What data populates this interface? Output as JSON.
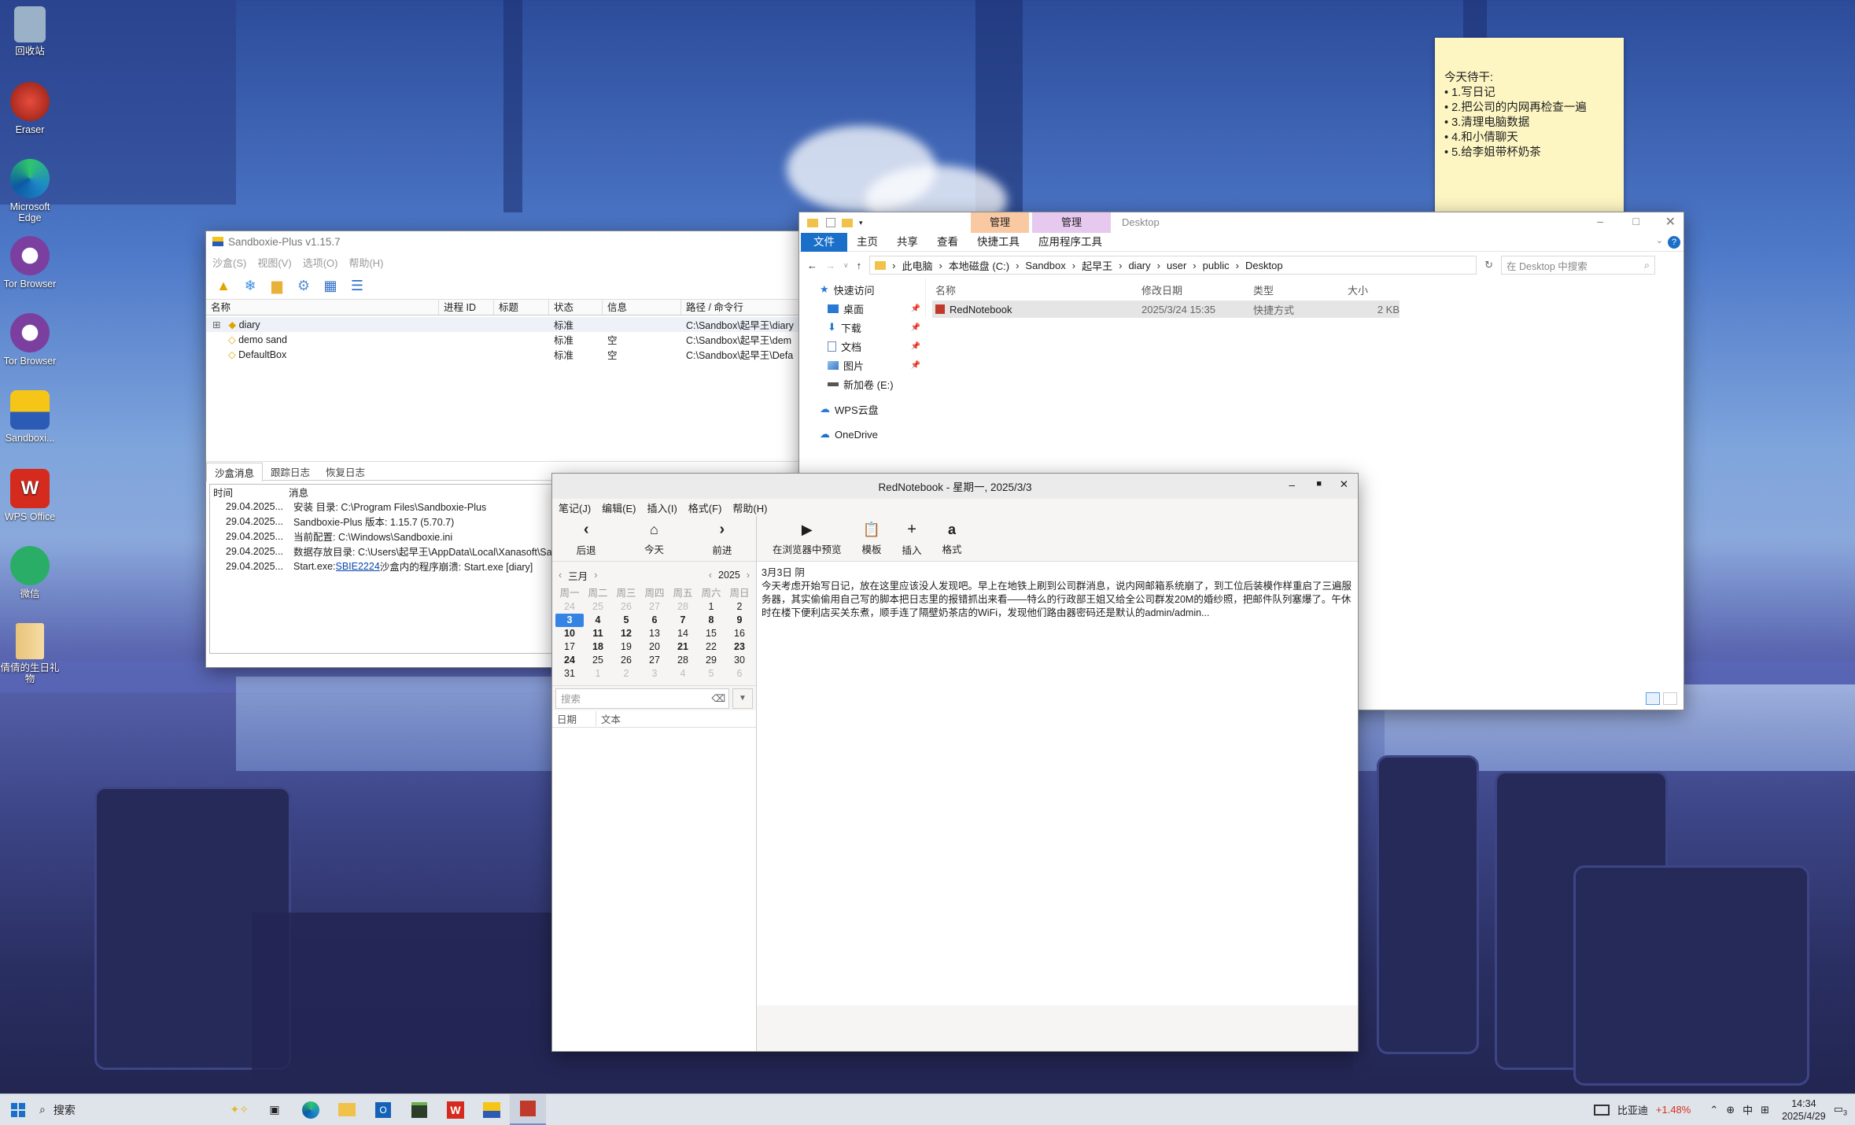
{
  "desktop": {
    "icons": [
      {
        "label": "回收站",
        "color": "#9bb1c8"
      },
      {
        "label": "Eraser",
        "color": "#c0392b"
      },
      {
        "label": "Microsoft Edge",
        "color": "#1e88c8"
      },
      {
        "label": "Tor Browser",
        "color": "#7b3fa0"
      },
      {
        "label": "Tor Browser",
        "color": "#7b3fa0"
      },
      {
        "label": "Sandboxi...",
        "color": "#e0a400"
      },
      {
        "label": "WPS Office",
        "color": "#d52b1e"
      },
      {
        "label": "微信",
        "color": "#2aae67"
      },
      {
        "label": "倩倩的生日礼物",
        "color": "#e8c37a"
      }
    ]
  },
  "sticky": {
    "title": "今天待干:",
    "items": [
      "• 1.写日记",
      "• 2.把公司的内网再检查一遍",
      "• 3.清理电脑数据",
      "• 4.和小倩聊天",
      "• 5.给李姐带杯奶茶"
    ]
  },
  "sandboxie": {
    "title": "Sandboxie-Plus v1.15.7",
    "menu": [
      "沙盒(S)",
      "视图(V)",
      "选项(O)",
      "帮助(H)"
    ],
    "columns": [
      "名称",
      "进程 ID",
      "标题",
      "状态",
      "信息",
      "路径 / 命令行"
    ],
    "rows": [
      {
        "name": "diary",
        "pid": "",
        "title": "",
        "status": "标准",
        "info": "",
        "path": "C:\\Sandbox\\起早王\\diary"
      },
      {
        "name": "demo sand",
        "pid": "",
        "title": "",
        "status": "标准",
        "info": "空",
        "path": "C:\\Sandbox\\起早王\\dem"
      },
      {
        "name": "DefaultBox",
        "pid": "",
        "title": "",
        "status": "标准",
        "info": "空",
        "path": "C:\\Sandbox\\起早王\\Defa"
      }
    ],
    "log_tabs": [
      "沙盒消息",
      "跟踪日志",
      "恢复日志"
    ],
    "log_columns": [
      "时间",
      "消息"
    ],
    "log": [
      {
        "time": "29.04.2025...",
        "msg": "安装 目录: C:\\Program Files\\Sandboxie-Plus",
        "link": "",
        "tail": ""
      },
      {
        "time": "29.04.2025...",
        "msg": "Sandboxie-Plus 版本: 1.15.7 (5.70.7)",
        "link": "",
        "tail": ""
      },
      {
        "time": "29.04.2025...",
        "msg": "当前配置: C:\\Windows\\Sandboxie.ini",
        "link": "",
        "tail": ""
      },
      {
        "time": "29.04.2025...",
        "msg": "数据存放目录: C:\\Users\\起早王\\AppData\\Local\\Xanasoft\\Sa",
        "link": "",
        "tail": ""
      },
      {
        "time": "29.04.2025...",
        "msg": "Start.exe: ",
        "link": "SBIE2224",
        "tail": " 沙盒内的程序崩溃: Start.exe [diary]"
      }
    ]
  },
  "explorer": {
    "title": "Desktop",
    "context_tabs": [
      "管理",
      "管理"
    ],
    "tabs": [
      "文件",
      "主页",
      "共享",
      "查看",
      "快捷工具",
      "应用程序工具"
    ],
    "breadcrumb": [
      "此电脑",
      "本地磁盘 (C:)",
      "Sandbox",
      "起早王",
      "diary",
      "user",
      "public",
      "Desktop"
    ],
    "search_placeholder": "在 Desktop 中搜索",
    "nav": [
      {
        "label": "快速访问",
        "icon": "star-icon",
        "indent": 0
      },
      {
        "label": "桌面",
        "icon": "desktop-icon",
        "indent": 1
      },
      {
        "label": "下载",
        "icon": "download-icon",
        "indent": 1
      },
      {
        "label": "文档",
        "icon": "document-icon",
        "indent": 1
      },
      {
        "label": "图片",
        "icon": "picture-icon",
        "indent": 1
      },
      {
        "label": "新加卷 (E:)",
        "icon": "drive-icon",
        "indent": 1
      },
      {
        "label": "WPS云盘",
        "icon": "cloud-icon",
        "indent": 0
      },
      {
        "label": "OneDrive",
        "icon": "cloud-icon",
        "indent": 0
      }
    ],
    "columns": [
      "名称",
      "修改日期",
      "类型",
      "大小"
    ],
    "files": [
      {
        "name": "RedNotebook",
        "date": "2025/3/24 15:35",
        "type": "快捷方式",
        "size": "2 KB"
      }
    ]
  },
  "rednotebook": {
    "title": "RedNotebook - 星期一, 2025/3/3",
    "menu": [
      "笔记(J)",
      "编辑(E)",
      "插入(I)",
      "格式(F)",
      "帮助(H)"
    ],
    "nav_buttons": [
      "后退",
      "今天",
      "前进"
    ],
    "tools": [
      "在浏览器中预览",
      "模板",
      "插入",
      "格式"
    ],
    "month": "三月",
    "year": "2025",
    "weekdays": [
      "周一",
      "周二",
      "周三",
      "周四",
      "周五",
      "周六",
      "周日"
    ],
    "search_placeholder": "搜索",
    "result_columns": [
      "日期",
      "文本"
    ],
    "entry_header": "3月3日 阴",
    "entry_text": "今天考虑开始写日记，放在这里应该没人发现吧。早上在地铁上刷到公司群消息，说内网邮箱系统崩了，到工位后装模作样重启了三遍服务器，其实偷偷用自己写的脚本把日志里的报错抓出来看——特么的行政部王姐又给全公司群发20M的婚纱照，把邮件队列塞爆了。午休时在楼下便利店买关东煮，顺手连了隔壁奶茶店的WiFi，发现他们路由器密码还是默认的admin/admin..."
  },
  "taskbar": {
    "search_placeholder": "搜索",
    "stock_name": "比亚迪",
    "stock_change": "+1.48%",
    "ime": "中",
    "time": "14:34",
    "date": "2025/4/29",
    "notif_count": "3"
  }
}
